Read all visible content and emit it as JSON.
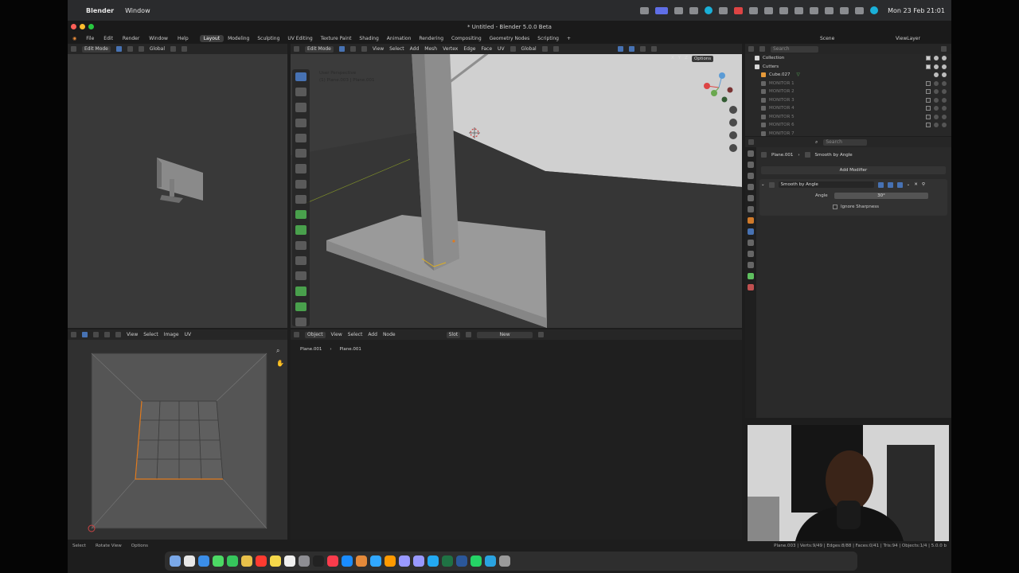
{
  "macos": {
    "apple_glyph": "",
    "app_name": "Blender",
    "menu": [
      "Window"
    ],
    "clock": "Mon 23 Feb  21:01"
  },
  "window": {
    "title": "* Untitled - Blender 5.0.0 Beta"
  },
  "topbar": {
    "menus": [
      "File",
      "Edit",
      "Render",
      "Window",
      "Help"
    ],
    "workspaces": [
      "Layout",
      "Modeling",
      "Sculpting",
      "UV Editing",
      "Texture Paint",
      "Shading",
      "Animation",
      "Rendering",
      "Compositing",
      "Geometry Nodes",
      "Scripting"
    ],
    "active_workspace": "Layout",
    "add_tab": "+",
    "scene": "Scene",
    "view_layer": "ViewLayer"
  },
  "left_viewport": {
    "mode": "Edit Mode",
    "orientation": "Global"
  },
  "main_viewport": {
    "mode": "Edit Mode",
    "menus": [
      "View",
      "Select",
      "Add",
      "Mesh",
      "Vertex",
      "Edge",
      "Face",
      "UV"
    ],
    "orientation": "Global",
    "overlay_line1": "User Perspective",
    "overlay_line2": "(1) Plane.003 | Plane.001",
    "axes": [
      "X",
      "Y",
      "Z"
    ],
    "options": "Options"
  },
  "uv_editor": {
    "menus": [
      "View",
      "Select",
      "Image",
      "UV"
    ]
  },
  "node_editor": {
    "context": "Object",
    "menus": [
      "View",
      "Select",
      "Add",
      "Node"
    ],
    "slot": "Slot",
    "new_label": "New",
    "breadcrumb": [
      "Plane.001",
      "Plane.001"
    ]
  },
  "outliner": {
    "search_placeholder": "Search",
    "rows": [
      {
        "label": "Collection",
        "dim": false
      },
      {
        "label": "Cutters",
        "dim": false
      },
      {
        "label": "Cube.027",
        "dim": false
      },
      {
        "label": "MONITOR 1",
        "dim": true
      },
      {
        "label": "MONITOR 2",
        "dim": true
      },
      {
        "label": "MONITOR 3",
        "dim": true
      },
      {
        "label": "MONITOR 4",
        "dim": true
      },
      {
        "label": "MONITOR 5",
        "dim": true
      },
      {
        "label": "MONITOR 6",
        "dim": true
      },
      {
        "label": "MONITOR 7",
        "dim": true
      }
    ]
  },
  "properties": {
    "search_placeholder": "Search",
    "breadcrumb_object": "Plane.001",
    "breadcrumb_modifier": "Smooth by Angle",
    "add_modifier": "Add Modifier",
    "modifier_name": "Smooth by Angle",
    "angle_label": "Angle",
    "angle_value": "30°",
    "ignore_sharpness": "Ignore Sharpness"
  },
  "statusbar": {
    "left": [
      "Select",
      "Rotate View",
      "Options"
    ],
    "right": "Plane.003 | Verts:9/49 | Edges:8/88 | Faces:0/41 | Tris:94 | Objects:1/4 | 5.0.0 b"
  },
  "colors": {
    "accent_blue": "#4772b3",
    "selection_orange": "#e07b1f",
    "viewport_bg": "#3d3d3d"
  },
  "dock_icons": [
    "finder-icon",
    "launchpad-icon",
    "safari-icon",
    "messages-icon",
    "facetime-icon",
    "chrome-icon",
    "calendar-icon",
    "notes-icon",
    "reminders-icon",
    "settings-icon",
    "tv-icon",
    "music-icon",
    "appstore-icon",
    "blender-icon",
    "photoshop-icon",
    "illustrator-icon",
    "aftereffects-icon",
    "premiere-icon",
    "vscode-icon",
    "excel-icon",
    "word-icon",
    "whatsapp-icon",
    "telegram-icon",
    "trash-icon"
  ]
}
